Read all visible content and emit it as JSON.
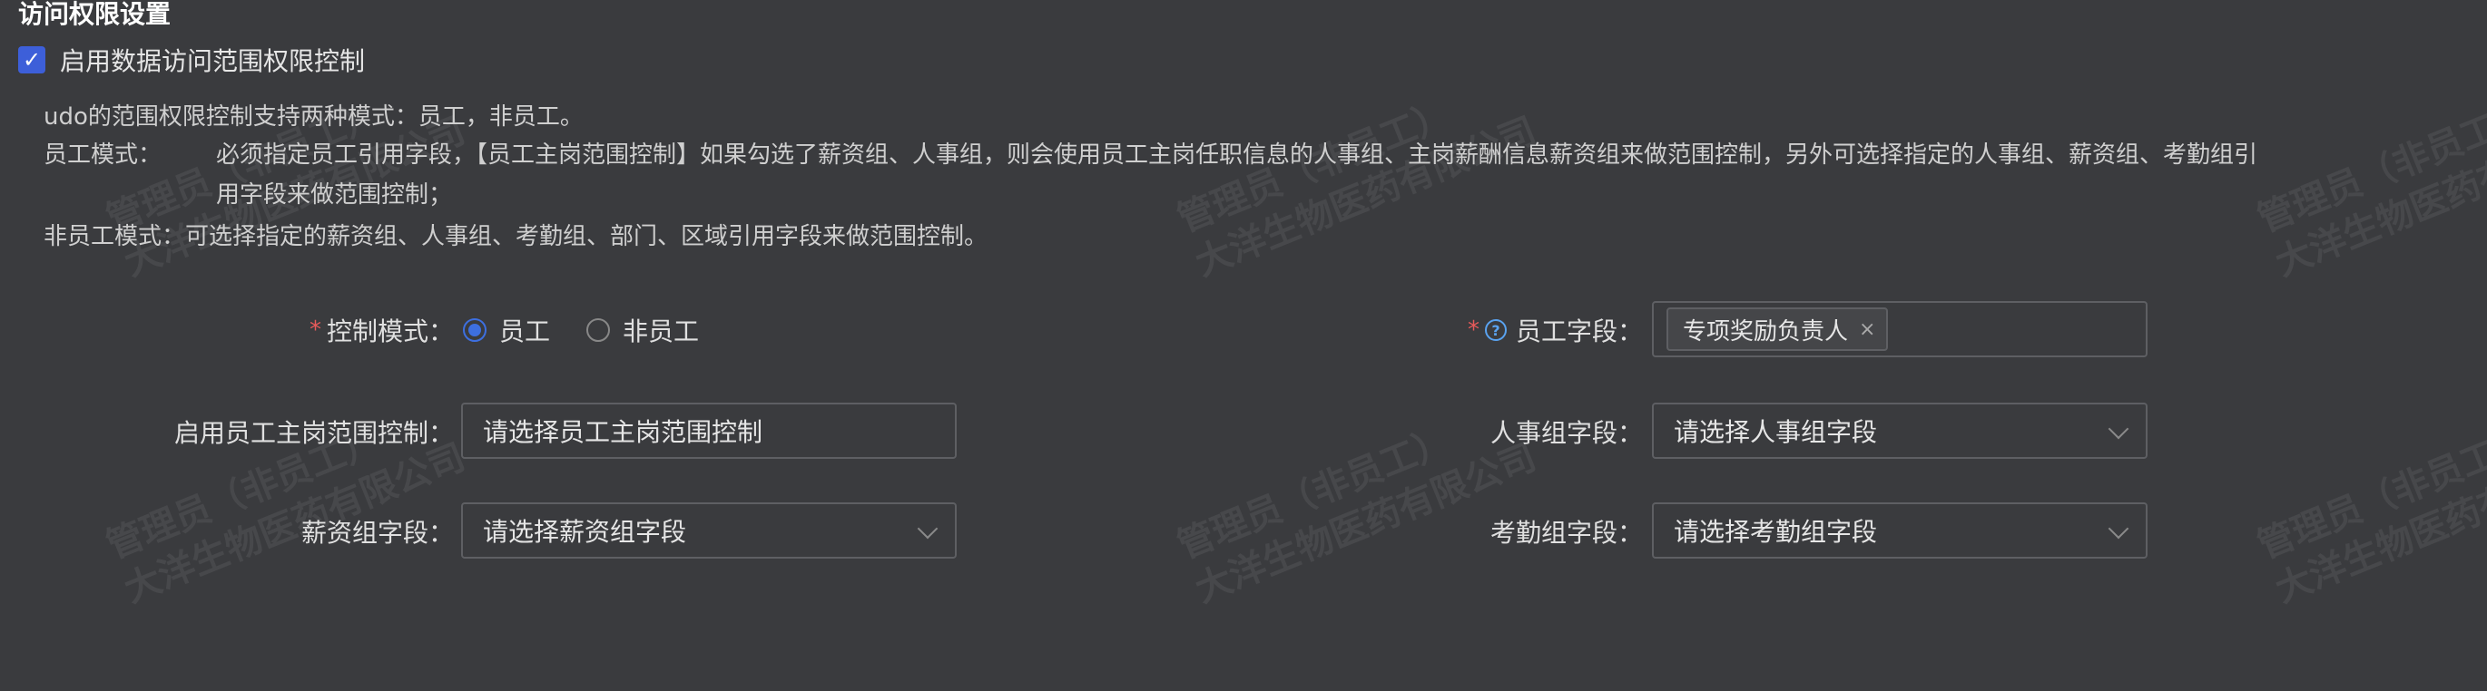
{
  "section": {
    "title": "访问权限设置",
    "enable_label": "启用数据访问范围权限控制",
    "enable_checked": true
  },
  "description": {
    "line1": "udo的范围权限控制支持两种模式：员工，非员工。",
    "employee_label": "员工模式：",
    "employee_text1": "必须指定员工引用字段，【员工主岗范围控制】如果勾选了薪资组、人事组，则会使用员工主岗任职信息的人事组、主岗薪酬信息薪资组来做范围控制，另外可选择指定的人事组、薪资组、考勤组引",
    "employee_text2": "用字段来做范围控制；",
    "nonemployee_label": "非员工模式：",
    "nonemployee_text": "可选择指定的薪资组、人事组、考勤组、部门、区域引用字段来做范围控制。"
  },
  "form": {
    "control_mode": {
      "label": "控制模式：",
      "required": "*",
      "options": [
        "员工",
        "非员工"
      ],
      "selected": "员工"
    },
    "employee_field": {
      "label": "员工字段：",
      "required": "*",
      "help_icon": "?",
      "tag": "专项奖励负责人",
      "tag_close": "×"
    },
    "primary_post_control": {
      "label": "启用员工主岗范围控制：",
      "placeholder": "请选择员工主岗范围控制"
    },
    "hr_group_field": {
      "label": "人事组字段：",
      "placeholder": "请选择人事组字段"
    },
    "salary_group_field": {
      "label": "薪资组字段：",
      "placeholder": "请选择薪资组字段"
    },
    "attendance_group_field": {
      "label": "考勤组字段：",
      "placeholder": "请选择考勤组字段"
    }
  },
  "watermark": {
    "line1": "管理员（非员工）",
    "line2": "大洋生物医药有限公司"
  },
  "colors": {
    "background": "#3a3b3e",
    "accent": "#3d5fd9",
    "required": "#e85a5a",
    "help": "#5aa3f0"
  }
}
